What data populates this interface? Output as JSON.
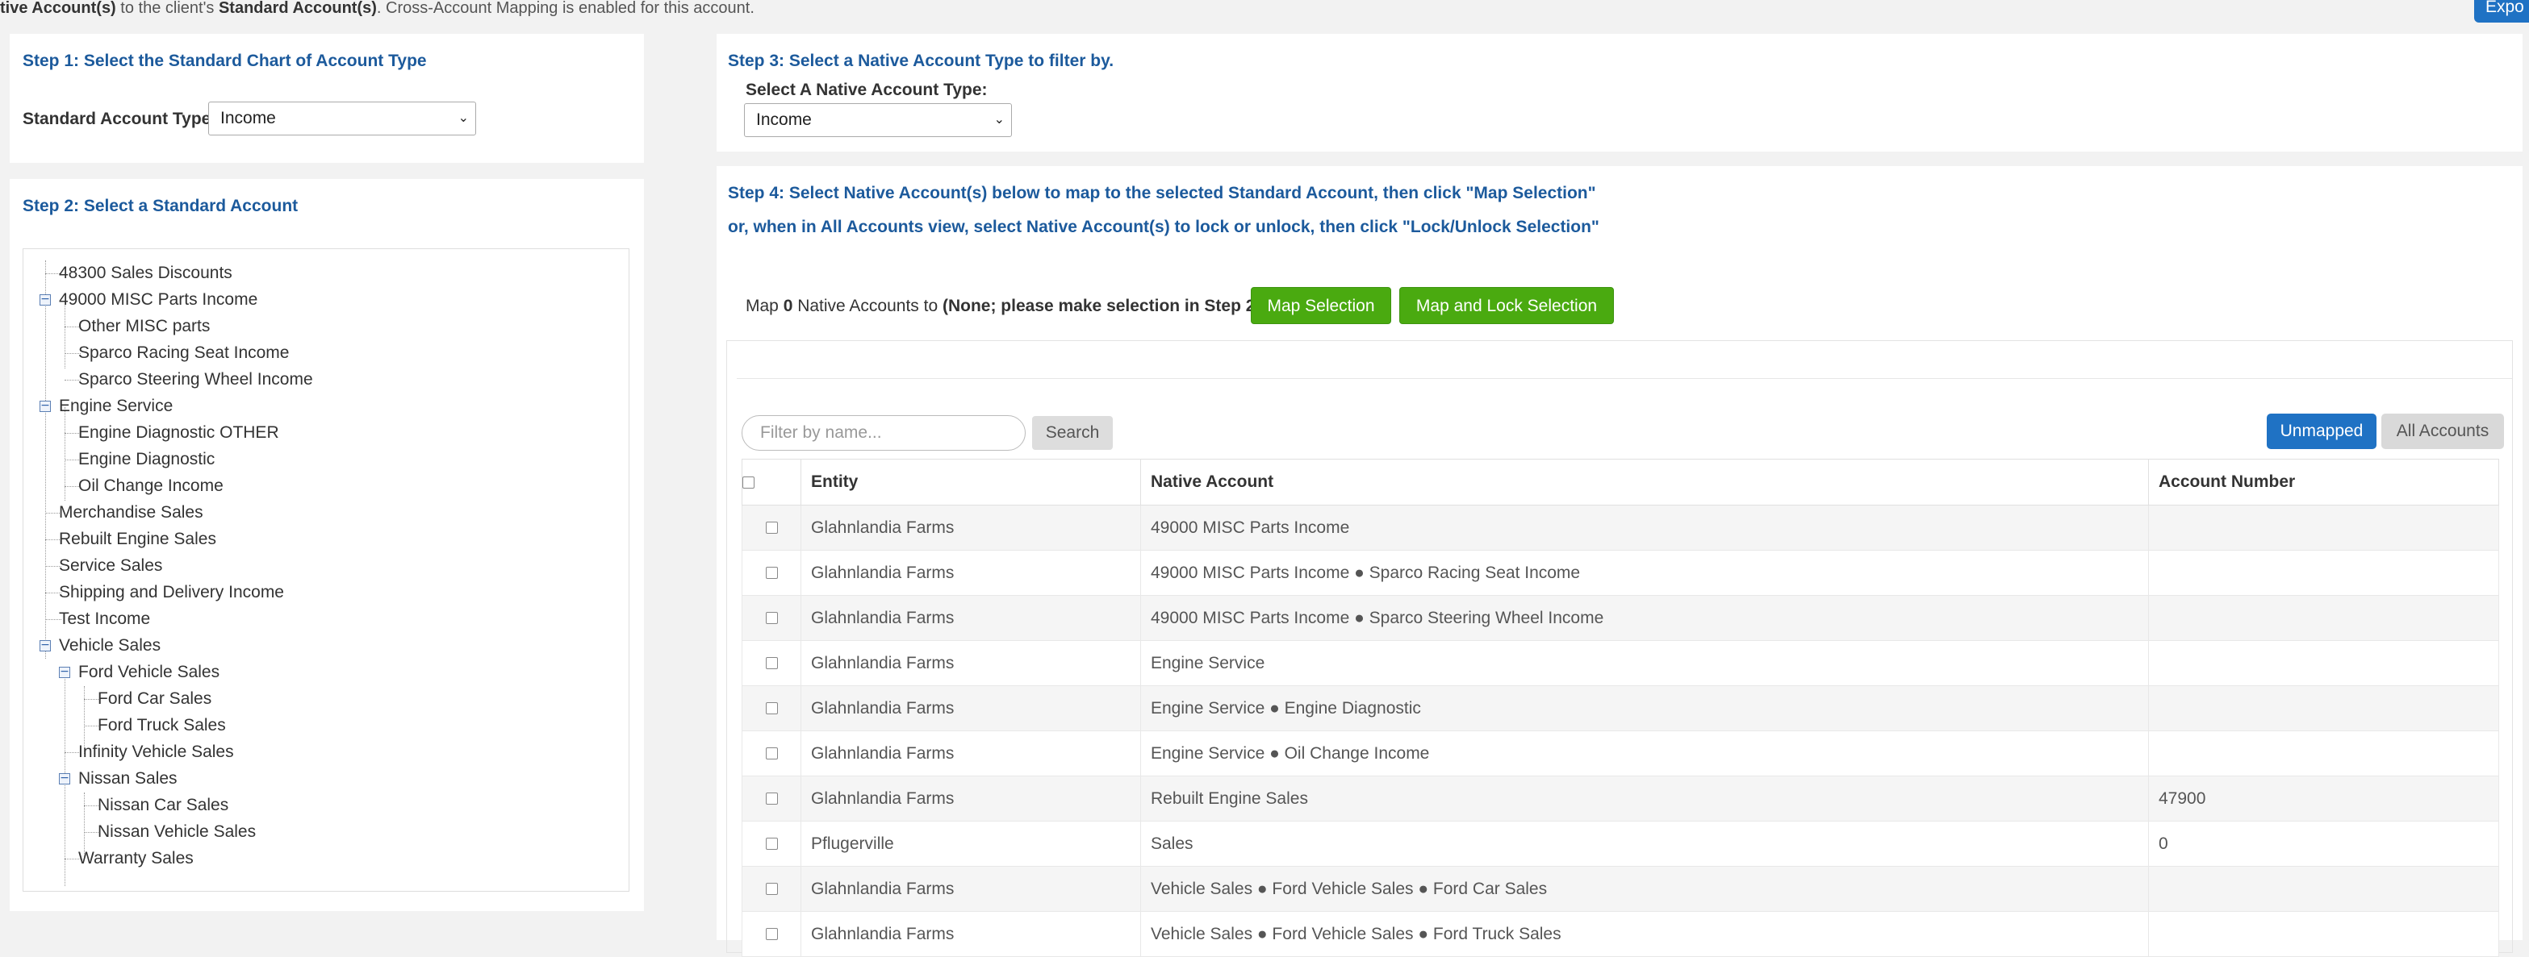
{
  "header": {
    "intro_prefix": "tive Account(s)",
    "intro_mid": " to the client's ",
    "intro_bold2": "Standard Account(s)",
    "intro_suffix": ". Cross-Account Mapping is enabled for this account.",
    "export_label": "Expo"
  },
  "step1": {
    "title": "Step 1: Select the Standard Chart of Account Type",
    "type_label": "Standard Account Type:",
    "type_value": "Income"
  },
  "step2": {
    "title": "Step 2: Select a Standard Account",
    "tree": [
      {
        "label": "48300 Sales Discounts"
      },
      {
        "label": "49000 MISC Parts Income"
      },
      {
        "label": "Other MISC parts"
      },
      {
        "label": "Sparco Racing Seat Income"
      },
      {
        "label": "Sparco Steering Wheel Income"
      },
      {
        "label": "Engine Service"
      },
      {
        "label": "Engine Diagnostic OTHER"
      },
      {
        "label": "Engine Diagnostic"
      },
      {
        "label": "Oil Change Income"
      },
      {
        "label": "Merchandise Sales"
      },
      {
        "label": "Rebuilt Engine Sales"
      },
      {
        "label": "Service Sales"
      },
      {
        "label": "Shipping and Delivery Income"
      },
      {
        "label": "Test Income"
      },
      {
        "label": "Vehicle Sales"
      },
      {
        "label": "Ford Vehicle Sales"
      },
      {
        "label": "Ford Car Sales"
      },
      {
        "label": "Ford Truck Sales"
      },
      {
        "label": "Infinity Vehicle Sales"
      },
      {
        "label": "Nissan Sales"
      },
      {
        "label": "Nissan Car Sales"
      },
      {
        "label": "Nissan Vehicle Sales"
      },
      {
        "label": "Warranty Sales"
      }
    ]
  },
  "step3": {
    "title": "Step 3: Select a Native Account Type to filter by.",
    "select_label": "Select A Native Account Type:",
    "select_value": "Income"
  },
  "step4": {
    "line1": "Step 4: Select Native Account(s) below to map to the selected Standard Account, then click \"Map Selection\"",
    "line2": "or, when in All Accounts view, select Native Account(s) to lock or unlock, then click \"Lock/Unlock Selection\"",
    "map_prefix": "Map ",
    "map_count": "0",
    "map_mid": " Native Accounts to ",
    "map_target": "(None; please make selection in Step 2)",
    "map_selection_label": "Map Selection",
    "map_lock_label": "Map and Lock Selection",
    "filter_placeholder": "Filter by name...",
    "search_label": "Search",
    "unmapped_label": "Unmapped",
    "all_accounts_label": "All Accounts",
    "columns": [
      "Entity",
      "Native Account",
      "Account Number"
    ],
    "rows": [
      {
        "entity": "Glahnlandia Farms",
        "native": "49000 MISC Parts Income",
        "number": ""
      },
      {
        "entity": "Glahnlandia Farms",
        "native": "49000 MISC Parts Income ● Sparco Racing Seat Income",
        "number": ""
      },
      {
        "entity": "Glahnlandia Farms",
        "native": "49000 MISC Parts Income ● Sparco Steering Wheel Income",
        "number": ""
      },
      {
        "entity": "Glahnlandia Farms",
        "native": "Engine Service",
        "number": ""
      },
      {
        "entity": "Glahnlandia Farms",
        "native": "Engine Service ● Engine Diagnostic",
        "number": ""
      },
      {
        "entity": "Glahnlandia Farms",
        "native": "Engine Service ● Oil Change Income",
        "number": ""
      },
      {
        "entity": "Glahnlandia Farms",
        "native": "Rebuilt Engine Sales",
        "number": "47900"
      },
      {
        "entity": "Pflugerville",
        "native": "Sales",
        "number": "0"
      },
      {
        "entity": "Glahnlandia Farms",
        "native": "Vehicle Sales ● Ford Vehicle Sales ● Ford Car Sales",
        "number": ""
      },
      {
        "entity": "Glahnlandia Farms",
        "native": "Vehicle Sales ● Ford Vehicle Sales ● Ford Truck Sales",
        "number": ""
      }
    ]
  }
}
